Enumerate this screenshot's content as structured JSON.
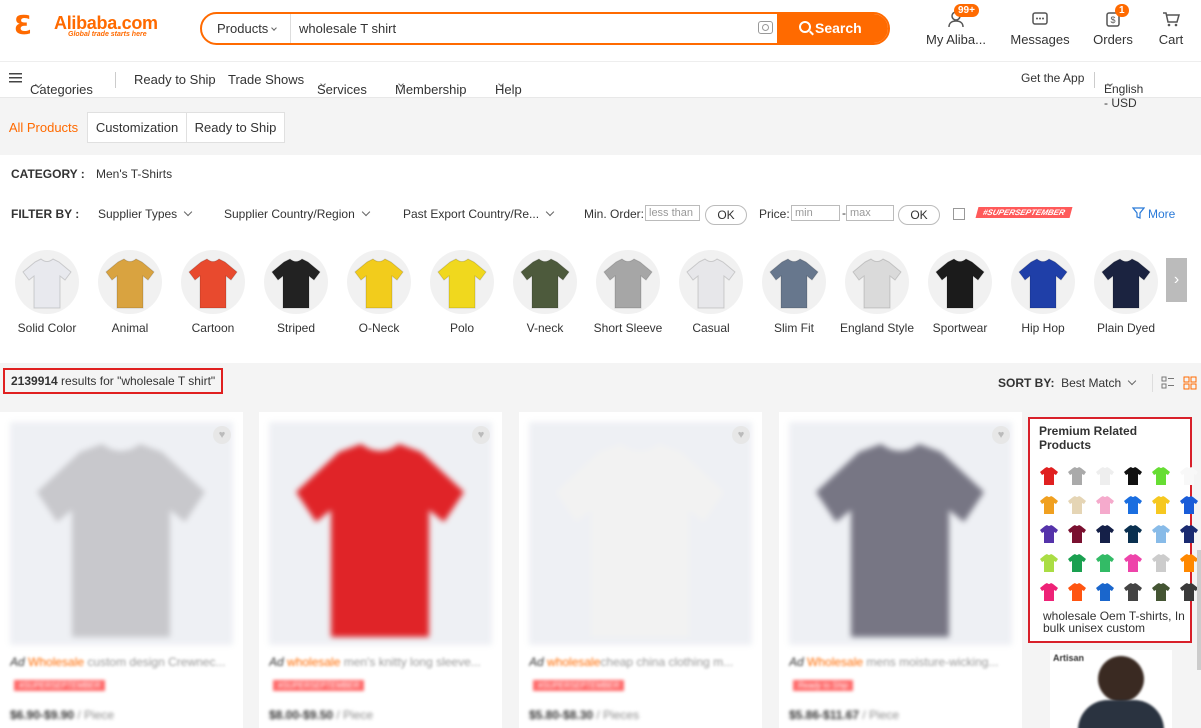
{
  "header": {
    "logo_brand": "Alibaba.com",
    "logo_tagline": "Global trade starts here",
    "search": {
      "category": "Products",
      "value": "wholesale T shirt",
      "button_label": "Search"
    },
    "icons": [
      {
        "icon": "user-icon",
        "label": "My Aliba...",
        "badge": "99+"
      },
      {
        "icon": "message-icon",
        "label": "Messages",
        "badge": ""
      },
      {
        "icon": "orders-icon",
        "label": "Orders",
        "badge": "1"
      },
      {
        "icon": "cart-icon",
        "label": "Cart",
        "badge": ""
      }
    ]
  },
  "nav": {
    "categories": "Categories",
    "items": [
      "Ready to Ship",
      "Trade Shows",
      "Services",
      "Membership",
      "Help"
    ],
    "get_app": "Get the App",
    "language": "English - USD"
  },
  "tabs": [
    "All Products",
    "Customization",
    "Ready to Ship"
  ],
  "filters": {
    "category_label": "CATEGORY :",
    "category_value": "Men's T-Shirts",
    "filter_label": "FILTER BY :",
    "supplier_types": "Supplier Types",
    "supplier_country": "Supplier Country/Region",
    "past_export": "Past Export Country/Re...",
    "min_order_label": "Min. Order:",
    "min_order_placeholder": "less than",
    "ok_label": "OK",
    "price_label": "Price:",
    "price_min_placeholder": "min",
    "price_dash": "-",
    "price_max_placeholder": "max",
    "promo_tag": "#SUPERSEPTEMBER",
    "more_label": "More"
  },
  "categories": [
    {
      "label": "Solid Color",
      "color": "#e8e9ee"
    },
    {
      "label": "Animal",
      "color": "#d9a340"
    },
    {
      "label": "Cartoon",
      "color": "#e84a2e"
    },
    {
      "label": "Striped",
      "color": "#222222"
    },
    {
      "label": "O-Neck",
      "color": "#f2cc1c"
    },
    {
      "label": "Polo",
      "color": "#f0d81e"
    },
    {
      "label": "V-neck",
      "color": "#4d5a3c"
    },
    {
      "label": "Short Sleeve",
      "color": "#a6a6a6"
    },
    {
      "label": "Casual",
      "color": "#e7e7ea"
    },
    {
      "label": "Slim Fit",
      "color": "#67778d"
    },
    {
      "label": "England Style",
      "color": "#dadada"
    },
    {
      "label": "Sportwear",
      "color": "#1b1b1b"
    },
    {
      "label": "Hip Hop",
      "color": "#1f3fa8"
    },
    {
      "label": "Plain Dyed",
      "color": "#1b2340"
    }
  ],
  "results": {
    "count": "2139914",
    "text": " results for \"wholesale T shirt\"",
    "sort_label": "SORT BY:",
    "sort_value": "Best Match"
  },
  "products": [
    {
      "ad": "Ad",
      "highlight": "Wholesale",
      "title": " custom design Crewnec...",
      "tag": "#SUPERSEPTEMBER",
      "price": "$6.90-$9.90",
      "unit": "/ Piece",
      "color": "#c8c8cc"
    },
    {
      "ad": "Ad",
      "highlight": "wholesale",
      "title": " men's knitty long sleeve...",
      "tag": "#SUPERSEPTEMBER",
      "price": "$8.00-$9.50",
      "unit": "/ Piece",
      "color": "#e02428"
    },
    {
      "ad": "Ad",
      "highlight": "wholesale",
      "title": "cheap china  clothing m...",
      "tag": "#SUPERSEPTEMBER",
      "price": "$5.80-$8.30",
      "unit": "/ Pieces",
      "color": "#f2f2f2"
    },
    {
      "ad": "Ad",
      "highlight": "Wholesale",
      "title": " mens moisture-wicking...",
      "tag": "Ready to Ship",
      "price": "$5.86-$11.67",
      "unit": "/ Piece",
      "color": "#777684"
    }
  ],
  "premium": {
    "title": "Premium Related Products",
    "description": "wholesale Oem T-shirts, In bulk unisex custom",
    "swatches": [
      "#e02020",
      "#aaaaaa",
      "#eeeeee",
      "#111111",
      "#66dd33",
      "#f8f8f8",
      "#f0a020",
      "#e5d5b5",
      "#f5aacc",
      "#1a6ee0",
      "#f6c820",
      "#1a5cd8",
      "#5533aa",
      "#7a1030",
      "#152048",
      "#0a3050",
      "#88bbe8",
      "#1a2a70",
      "#aadd44",
      "#1aa050",
      "#33bb66",
      "#ee44aa",
      "#cccccc",
      "#ff8800",
      "#ee2277",
      "#ff5511",
      "#1a66cc",
      "#444444",
      "#445533",
      "#3a3a3a"
    ]
  }
}
